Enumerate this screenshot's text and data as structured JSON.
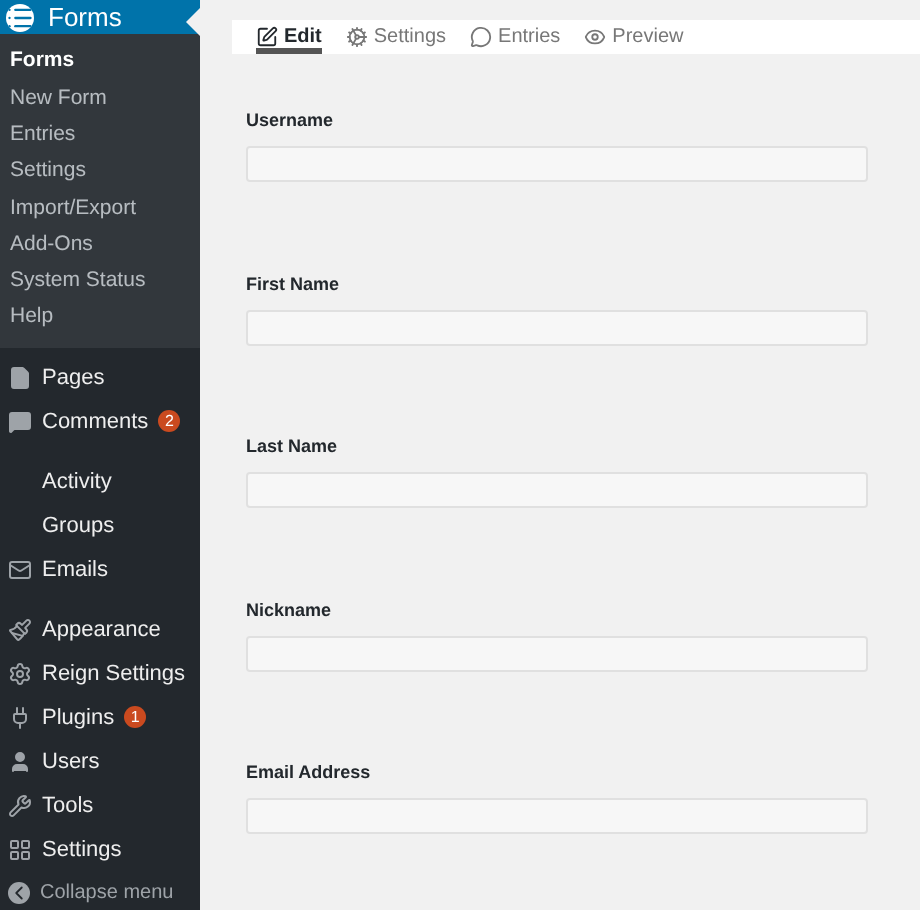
{
  "sidebar": {
    "current": {
      "label": "Forms",
      "selected": true,
      "submenu": [
        {
          "label": "Forms",
          "selected": true
        },
        {
          "label": "New Form",
          "selected": false
        },
        {
          "label": "Entries",
          "selected": false
        },
        {
          "label": "Settings",
          "selected": false
        },
        {
          "label": "Import/Export",
          "selected": false
        },
        {
          "label": "Add-Ons",
          "selected": false
        },
        {
          "label": "System Status",
          "selected": false
        },
        {
          "label": "Help",
          "selected": false
        }
      ]
    },
    "groups": [
      [
        {
          "kind": "pages",
          "label": "Pages"
        },
        {
          "kind": "comments",
          "label": "Comments",
          "badge": "2"
        }
      ],
      [
        {
          "kind": "none",
          "label": "Activity"
        },
        {
          "kind": "none",
          "label": "Groups"
        },
        {
          "kind": "emails",
          "label": "Emails"
        }
      ],
      [
        {
          "kind": "appearance",
          "label": "Appearance"
        },
        {
          "kind": "gear",
          "label": "Reign Settings"
        },
        {
          "kind": "plugins",
          "label": "Plugins",
          "badge": "1"
        },
        {
          "kind": "users",
          "label": "Users"
        },
        {
          "kind": "tools",
          "label": "Tools"
        },
        {
          "kind": "settings",
          "label": "Settings"
        }
      ]
    ],
    "collapse": "Collapse menu"
  },
  "tabs": [
    {
      "kind": "edit",
      "label": "Edit",
      "selected": true
    },
    {
      "kind": "settings",
      "label": "Settings",
      "selected": false
    },
    {
      "kind": "entries",
      "label": "Entries",
      "selected": false
    },
    {
      "kind": "preview",
      "label": "Preview",
      "selected": false
    }
  ],
  "fields": [
    {
      "label": "Username"
    },
    {
      "label": "First Name"
    },
    {
      "label": "Last Name"
    },
    {
      "label": "Nickname"
    },
    {
      "label": "Email Address"
    }
  ]
}
